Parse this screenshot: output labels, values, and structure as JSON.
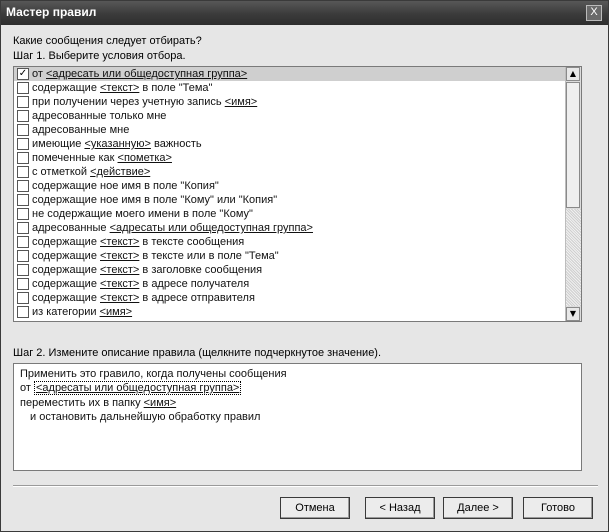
{
  "window": {
    "title": "Мастер правил",
    "close_label": "X"
  },
  "question": "Какие сообщения следует отбирать?",
  "step1_label": "Шаг 1. Выберите условия отбора.",
  "conditions": [
    {
      "checked": true,
      "pre": "от ",
      "link": "<адресать или общедоступная группа>",
      "post": ""
    },
    {
      "checked": false,
      "pre": "содержащие ",
      "link": "<текст>",
      "post": " в поле \"Тема\""
    },
    {
      "checked": false,
      "pre": "при получении через учетную запись ",
      "link": "<имя>",
      "post": ""
    },
    {
      "checked": false,
      "pre": "адресованные только мне",
      "link": "",
      "post": ""
    },
    {
      "checked": false,
      "pre": "адресованные мне",
      "link": "",
      "post": ""
    },
    {
      "checked": false,
      "pre": "имеющие ",
      "link": "<указанную>",
      "post": " важность"
    },
    {
      "checked": false,
      "pre": "помеченные как ",
      "link": "<пометка>",
      "post": ""
    },
    {
      "checked": false,
      "pre": "с отметкой ",
      "link": "<действие>",
      "post": ""
    },
    {
      "checked": false,
      "pre": "содержащие ное имя в поле \"Копия\"",
      "link": "",
      "post": ""
    },
    {
      "checked": false,
      "pre": "содержащие ное имя в поле \"Кому\" или \"Копия\"",
      "link": "",
      "post": ""
    },
    {
      "checked": false,
      "pre": "не содержащие моего имени в поле \"Кому\"",
      "link": "",
      "post": ""
    },
    {
      "checked": false,
      "pre": "адресованные ",
      "link": "<адресаты или общедоступная группа>",
      "post": ""
    },
    {
      "checked": false,
      "pre": "содержащие ",
      "link": "<текст>",
      "post": " в тексте сообщения"
    },
    {
      "checked": false,
      "pre": "содержащие ",
      "link": "<текст>",
      "post": " в тексте или в поле \"Тема\""
    },
    {
      "checked": false,
      "pre": "содержащие ",
      "link": "<текст>",
      "post": " в заголовке сообщения"
    },
    {
      "checked": false,
      "pre": "содержащие ",
      "link": "<текст>",
      "post": " в адресе получателя"
    },
    {
      "checked": false,
      "pre": "содержащие ",
      "link": "<текст>",
      "post": " в адресе отправителя"
    },
    {
      "checked": false,
      "pre": "из категории ",
      "link": "<имя>",
      "post": ""
    }
  ],
  "step2_label": "Шаг 2. Измените описание правила (щелкните подчеркнутое значение).",
  "description": {
    "line1": "Применить это гравило, когда получены сообщения",
    "line2_pre": "от ",
    "line2_link": "<адресаты или общедоступная группа>",
    "line3_pre": "переместить их в папку ",
    "line3_link": "<имя>",
    "line4": "и остановить дальнейшую обработку правил"
  },
  "buttons": {
    "cancel": "Отмена",
    "back": "< Назад",
    "next": "Далее >",
    "finish": "Готово"
  },
  "scrollbar": {
    "up": "▲",
    "down": "▼"
  }
}
